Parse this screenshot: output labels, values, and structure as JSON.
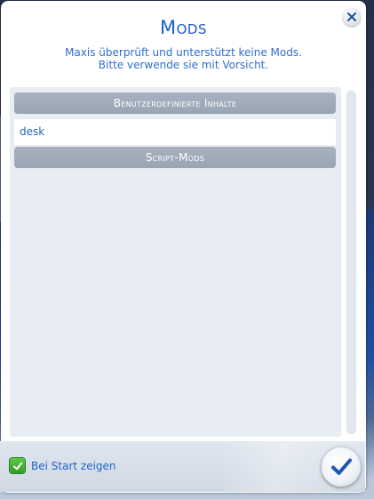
{
  "dialog": {
    "title": "Mods",
    "subtitle_line1": "Maxis überprüft und unterstützt keine Mods.",
    "subtitle_line2": "Bitte verwende sie mit Vorsicht.",
    "close_icon": "close-icon"
  },
  "sections": [
    {
      "header": "Benutzerdefinierte Inhalte",
      "items": [
        "desk"
      ]
    },
    {
      "header": "Script-Mods",
      "items": []
    }
  ],
  "footer": {
    "checkbox_label": "Bei Start zeigen",
    "checkbox_checked": true,
    "confirm_icon": "checkmark-icon"
  },
  "colors": {
    "accent": "#1a5dc7",
    "section_header_bg": "#9ea9b8",
    "panel_bg": "#e8edf4",
    "checkbox_green": "#3fae31"
  }
}
